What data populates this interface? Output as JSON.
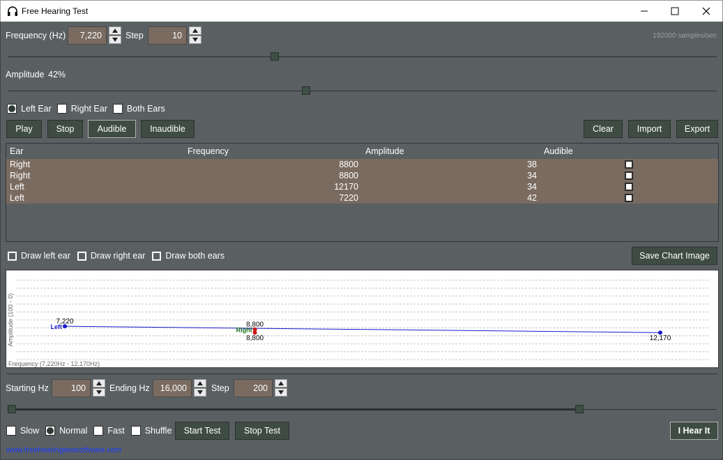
{
  "window": {
    "title": "Free Hearing Test"
  },
  "header": {
    "frequency_label": "Frequency (Hz)",
    "frequency_value": "7,220",
    "step_label": "Step",
    "step_value": "10",
    "sample_rate": "192000 samples/sec",
    "amplitude_label": "Amplitude",
    "amplitude_value": "42%",
    "frequency_slider_fraction": 0.375,
    "amplitude_slider_fraction": 0.42
  },
  "ear_options": [
    {
      "label": "Left Ear",
      "selected": true
    },
    {
      "label": "Right Ear",
      "selected": false
    },
    {
      "label": "Both Ears",
      "selected": false
    }
  ],
  "controls": {
    "play": "Play",
    "stop": "Stop",
    "audible": "Audible",
    "inaudible": "Inaudible",
    "clear": "Clear",
    "import": "Import",
    "export": "Export"
  },
  "table": {
    "headers": [
      "Ear",
      "Frequency",
      "Amplitude",
      "Audible"
    ],
    "rows": [
      {
        "ear": "Right",
        "frequency": "8800",
        "amplitude": "38"
      },
      {
        "ear": "Right",
        "frequency": "8800",
        "amplitude": "34"
      },
      {
        "ear": "Left",
        "frequency": "12170",
        "amplitude": "34"
      },
      {
        "ear": "Left",
        "frequency": "7220",
        "amplitude": "42"
      }
    ]
  },
  "draw_options": [
    {
      "label": "Draw left ear"
    },
    {
      "label": "Draw right ear"
    },
    {
      "label": "Draw both ears"
    }
  ],
  "save_chart_label": "Save Chart Image",
  "chart_data": {
    "type": "line",
    "ylabel": "Amplitude (100 - 0)",
    "xlabel": "Frequency (7,220Hz - 12,170Hz)",
    "xlim": [
      7220,
      12170
    ],
    "ylim": [
      100,
      0
    ],
    "grid": true,
    "series": [
      {
        "name": "Left",
        "color": "#1a1acc",
        "points": [
          {
            "x": 7220,
            "y": 42,
            "label": "7,220"
          },
          {
            "x": 12170,
            "y": 34,
            "label": "12,170"
          }
        ]
      },
      {
        "name": "Right",
        "color": "#cc1a1a",
        "points": [
          {
            "x": 8800,
            "y": 38,
            "label": "8,800"
          },
          {
            "x": 8800,
            "y": 34,
            "label": "8,800"
          }
        ]
      }
    ]
  },
  "test_range": {
    "starting_label": "Starting Hz",
    "starting_value": "100",
    "ending_label": "Ending Hz",
    "ending_value": "16,000",
    "step_label": "Step",
    "step_value": "200",
    "range_start_fraction": 0.0,
    "range_end_fraction": 0.81
  },
  "speed_options": [
    {
      "label": "Slow",
      "selected": false,
      "type": "checkbox"
    },
    {
      "label": "Normal",
      "selected": true,
      "type": "radio"
    },
    {
      "label": "Fast",
      "selected": false,
      "type": "checkbox"
    },
    {
      "label": "Shuffle",
      "selected": false,
      "type": "checkbox"
    }
  ],
  "test_buttons": {
    "start": "Start Test",
    "stop": "Stop Test",
    "hear": "I Hear It"
  },
  "footer": {
    "link": "www.freehearingtestsoftware.com"
  }
}
